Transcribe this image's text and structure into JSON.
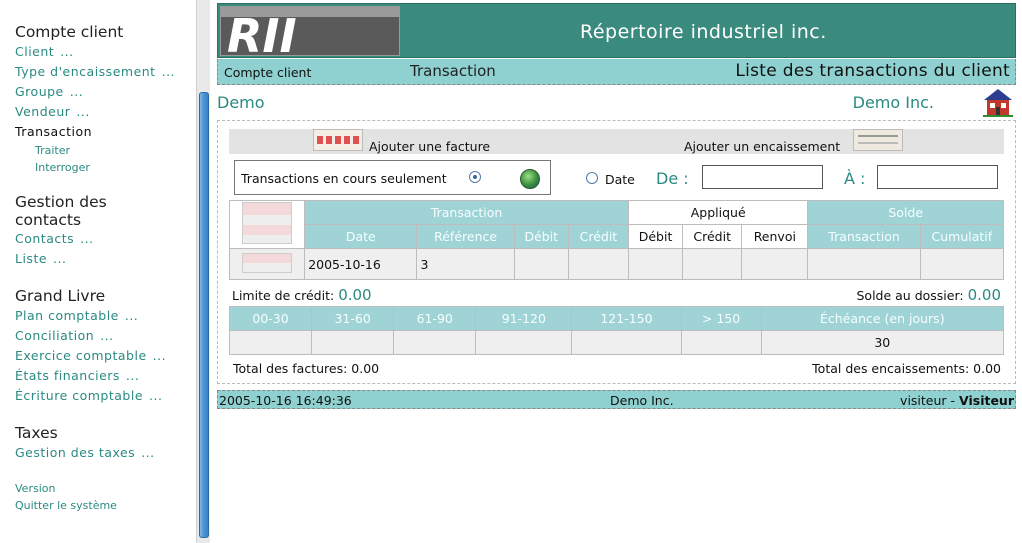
{
  "sidebar": {
    "sections": [
      {
        "title": "Compte client",
        "links": [
          "Client",
          "Type d'encaissement",
          "Groupe",
          "Vendeur"
        ],
        "active": "Transaction",
        "subs": [
          "Traiter",
          "Interroger"
        ]
      },
      {
        "title": "Gestion des contacts",
        "links": [
          "Contacts",
          "Liste"
        ]
      },
      {
        "title": "Grand Livre",
        "links": [
          "Plan comptable",
          "Conciliation",
          "Exercice comptable",
          "États financiers",
          "Écriture comptable"
        ]
      },
      {
        "title": "Taxes",
        "links": [
          "Gestion des taxes"
        ]
      }
    ],
    "dots": "...",
    "version": "Version",
    "quit": "Quitter le système"
  },
  "banner": {
    "logo_text": "RII",
    "title": "Répertoire industriel inc."
  },
  "crumbs": {
    "client": "Compte client",
    "section": "Transaction",
    "page": "Liste des transactions du client"
  },
  "user": {
    "left": "Demo",
    "right": "Demo Inc."
  },
  "actions": {
    "add_invoice": "Ajouter une facture",
    "add_receipt": "Ajouter un encaissement"
  },
  "filter": {
    "current_only": "Transactions en cours seulement",
    "date": "Date",
    "from": "De :",
    "to": "À :",
    "from_value": "",
    "to_value": ""
  },
  "table": {
    "group_transaction": "Transaction",
    "group_applied": "Appliqué",
    "group_balance": "Solde",
    "cols": [
      "Date",
      "Référence",
      "Débit",
      "Crédit",
      "Débit",
      "Crédit",
      "Renvoi",
      "Transaction",
      "Cumulatif"
    ],
    "rows": [
      {
        "date": "2005-10-16",
        "reference": "3",
        "debit": "",
        "credit": "",
        "app_debit": "",
        "app_credit": "",
        "renvoi": "",
        "sol_transaction": "",
        "sol_cumulatif": ""
      }
    ]
  },
  "limits": {
    "credit_label": "Limite de crédit:",
    "credit_value": "0.00",
    "balance_label": "Solde au dossier:",
    "balance_value": "0.00"
  },
  "aging": {
    "headers": [
      "00-30",
      "31-60",
      "61-90",
      "91-120",
      "121-150",
      "> 150",
      "Échéance (en jours)"
    ],
    "values": [
      "",
      "",
      "",
      "",
      "",
      "",
      "30"
    ]
  },
  "totals": {
    "invoices": "Total des factures: 0.00",
    "receipts": "Total des encaissements: 0.00"
  },
  "footer": {
    "timestamp": "2005-10-16 16:49:36",
    "company": "Demo Inc.",
    "user_prefix": "visiteur - ",
    "user_name": "Visiteur"
  },
  "colors": {
    "teal": "#3a8a7e",
    "light_teal": "#8fd0d0",
    "header_teal": "#9fd3d6",
    "link": "#2a8a82"
  }
}
